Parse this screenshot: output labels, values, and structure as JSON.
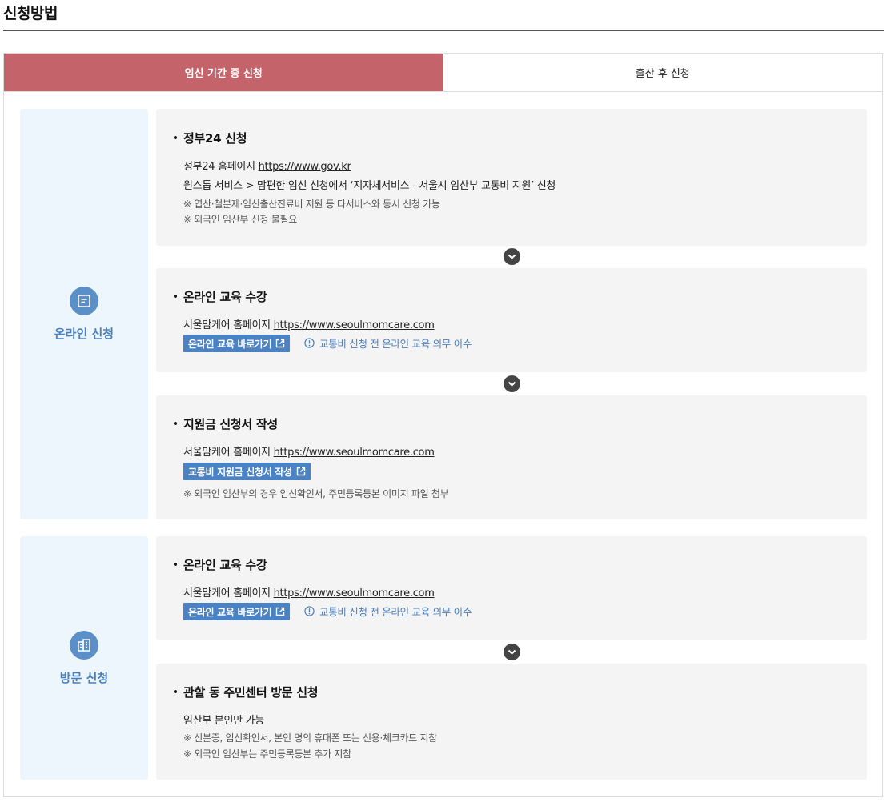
{
  "page_title": "신청방법",
  "tabs": [
    {
      "label": "임신 기간 중 신청",
      "active": true
    },
    {
      "label": "출산 후 신청",
      "active": false
    }
  ],
  "colors": {
    "tab_active": "#c5636b",
    "accent": "#4a82c4",
    "side_bg": "#eef6fd",
    "card_bg": "#f4f4f4"
  },
  "online": {
    "label": "온라인 신청",
    "icon": "document-icon",
    "steps": [
      {
        "title": "정부24 신청",
        "line1_prefix": "정부24 홈페이지 ",
        "line1_link": "https://www.gov.kr",
        "line2": "원스톱 서비스 > 맘편한 임신 신청에서 ‘지자체서비스 - 서울시 임산부 교통비 지원’ 신청",
        "notes": [
          "※ 엽산·철분제·임신출산진료비 지원 등 타서비스와 동시 신청 가능",
          "※ 외국인 임산부 신청 불필요"
        ]
      },
      {
        "title": "온라인 교육 수강",
        "line1_prefix": "서울맘케어 홈페이지 ",
        "line1_link": "https://www.seoulmomcare.com",
        "button": "온라인 교육 바로가기",
        "info": "교통비 신청 전 온라인 교육 의무 이수"
      },
      {
        "title": "지원금 신청서 작성",
        "line1_prefix": "서울맘케어 홈페이지 ",
        "line1_link": "https://www.seoulmomcare.com",
        "button": "교통비 지원금 신청서 작성",
        "note": "※ 외국인 임산부의 경우 임신확인서, 주민등록등본 이미지 파일 첨부"
      }
    ]
  },
  "visit": {
    "label": "방문 신청",
    "icon": "building-icon",
    "steps": [
      {
        "title": "온라인 교육 수강",
        "line1_prefix": "서울맘케어 홈페이지 ",
        "line1_link": "https://www.seoulmomcare.com",
        "button": "온라인 교육 바로가기",
        "info": "교통비 신청 전 온라인 교육 의무 이수"
      },
      {
        "title": "관할 동 주민센터 방문 신청",
        "line1": "임산부 본인만 가능",
        "notes": [
          "※ 신분증, 임신확인서, 본인 명의 휴대폰 또는 신용·체크카드 지참",
          "※ 외국인 임산부는 주민등록등본 추가 지참"
        ]
      }
    ]
  }
}
